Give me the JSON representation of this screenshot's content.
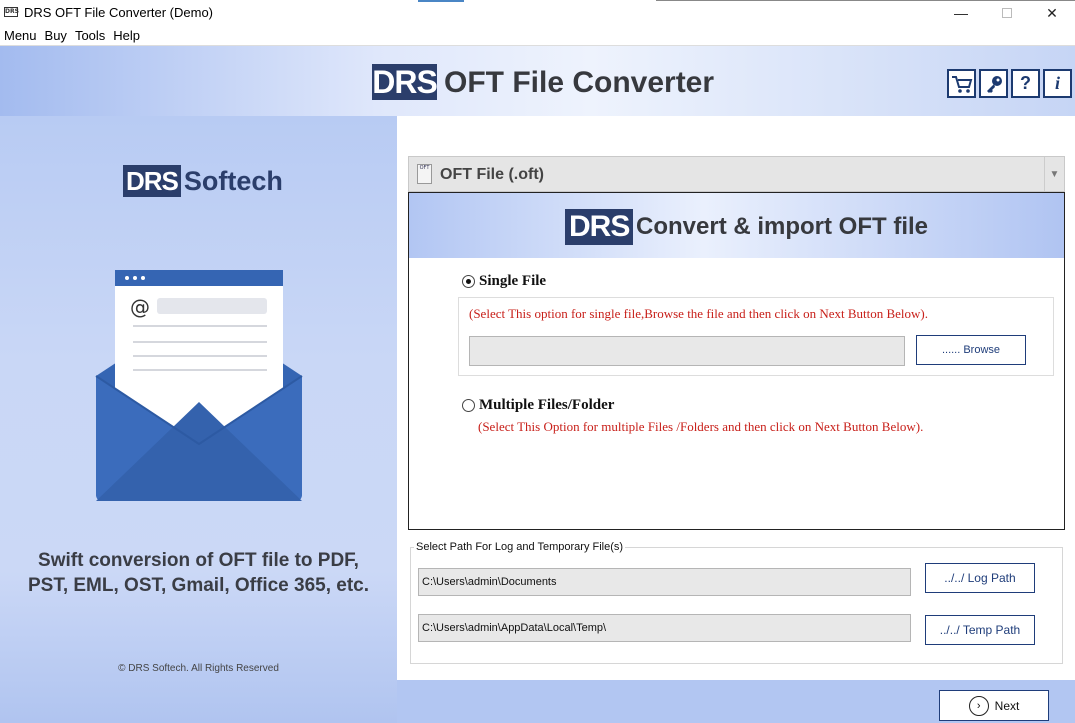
{
  "window": {
    "app_icon_text": "DRS",
    "title": "DRS OFT File Converter (Demo)",
    "minimize": "—",
    "close": "✕"
  },
  "menu": {
    "items": [
      "Menu",
      "Buy",
      "Tools",
      "Help"
    ]
  },
  "header": {
    "brand_badge": "DRS",
    "title": "OFT File Converter",
    "icons": [
      {
        "name": "cart-icon",
        "glyph": "🛒"
      },
      {
        "name": "key-icon",
        "glyph": "🔑"
      },
      {
        "name": "help-icon",
        "glyph": "?"
      },
      {
        "name": "info-icon",
        "glyph": "i"
      }
    ]
  },
  "left": {
    "brand_badge": "DRS",
    "brand_name": "Softech",
    "tagline_line1": "Swift conversion of OFT file to PDF,",
    "tagline_line2": "PST, EML, OST, Gmail, Office 365, etc.",
    "copyright": "© DRS Softech. All Rights Reserved"
  },
  "filetype": {
    "icon_text": "OFT",
    "selected": "OFT File (.oft)"
  },
  "panel": {
    "badge": "DRS",
    "title": "Convert & import OFT file",
    "single_label": "Single File",
    "single_hint": "(Select This option for single file,Browse the file and then click on Next Button Below).",
    "single_value": "",
    "browse_label": "...... Browse",
    "multi_label": "Multiple Files/Folder",
    "multi_hint": "(Select This Option for multiple Files /Folders and then click on Next Button Below)."
  },
  "paths": {
    "legend": "Select Path For Log and Temporary File(s)",
    "log_path": "C:\\Users\\admin\\Documents",
    "temp_path": "C:\\Users\\admin\\AppData\\Local\\Temp\\",
    "log_button": "../../ Log Path",
    "temp_button": "../../ Temp Path"
  },
  "footer": {
    "next_label": "Next",
    "next_glyph": "›"
  },
  "colors": {
    "brand_navy": "#2b3e6b",
    "hint_red": "#c8201a",
    "background_blue": "#b6c9f2"
  }
}
